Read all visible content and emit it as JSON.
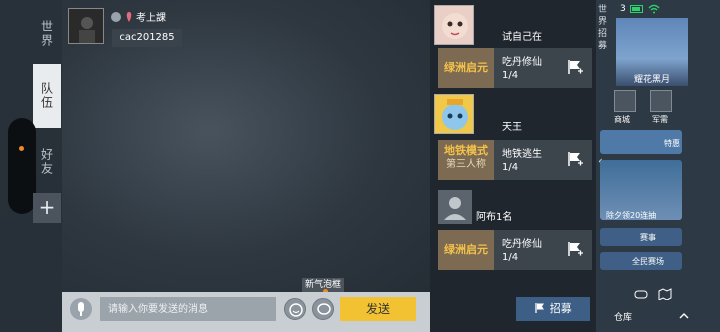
{
  "rail": {
    "tabs": [
      {
        "label": "世界",
        "active": false
      },
      {
        "label": "队伍",
        "active": true
      },
      {
        "label": "好友",
        "active": false
      }
    ],
    "plus_label": "+"
  },
  "chat_header": {
    "user_name": "考上課",
    "user_id": "cac201285"
  },
  "bubble_tip": "新气泡框",
  "input": {
    "placeholder": "请输入你要发送的消息",
    "send_label": "发送"
  },
  "team_list": [
    {
      "name": "试自己在",
      "mode": "绿洲启元",
      "mode_sub": "",
      "title": "吃丹修仙",
      "count": "1/4"
    },
    {
      "name": "天王",
      "mode": "地铁模式",
      "mode_sub": "第三人称",
      "title": "地铁逃生",
      "count": "1/4"
    },
    {
      "name": "阿布1名",
      "mode": "绿洲启元",
      "mode_sub": "",
      "title": "吃丹修仙",
      "count": "1/4"
    }
  ],
  "recruit_label": "招募",
  "game_panel": {
    "world_label": "世界招募",
    "battery": "3",
    "promo_label": "耀花黑月",
    "shop_label": "商城",
    "armory_label": "军需",
    "special_label": "特惠",
    "draw_label": "除夕领20连抽",
    "event_label": "赛事",
    "arena_label": "全民赛场",
    "warehouse_label": "仓库"
  },
  "colors": {
    "accent_orange": "#f08a22",
    "send_yellow": "#f2c233",
    "mode_gold": "#f4c24a",
    "recruit_blue": "#3d5f86"
  }
}
